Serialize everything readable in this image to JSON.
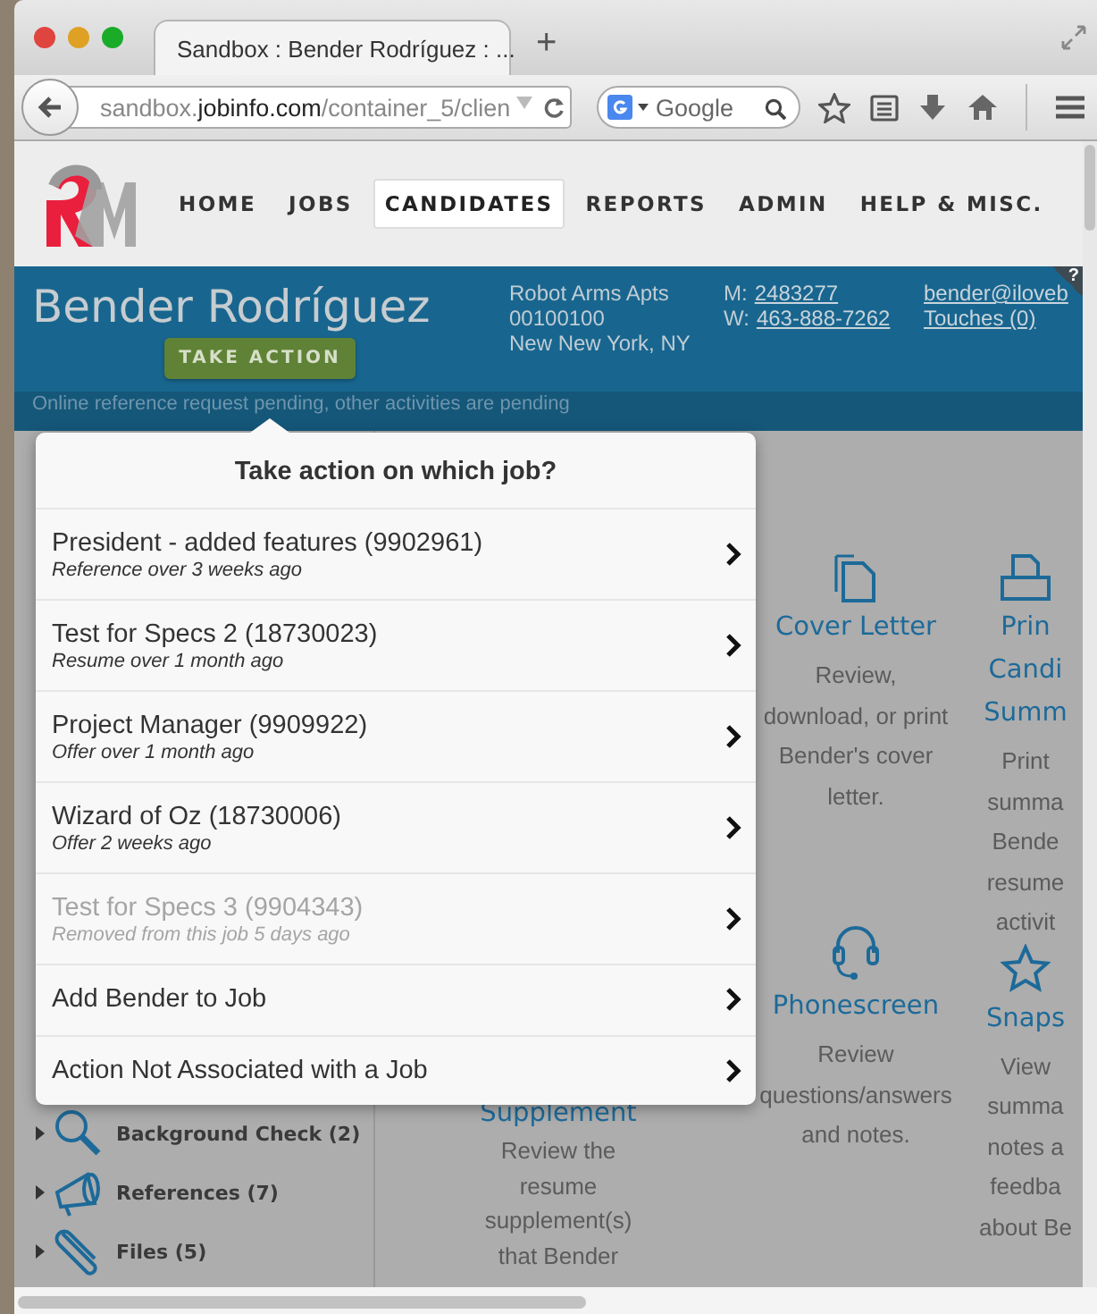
{
  "browser": {
    "tab_title": "Sandbox : Bender Rodríguez : ...",
    "new_tab": "+",
    "url": "sandbox.**jobinfo.com**/container_5/clien",
    "search": {
      "placeholder": "Google"
    }
  },
  "nav": {
    "items": [
      {
        "label": "HOME",
        "selected": false
      },
      {
        "label": "JOBS",
        "selected": false
      },
      {
        "label": "CANDIDATES",
        "selected": true
      },
      {
        "label": "REPORTS",
        "selected": false
      },
      {
        "label": "ADMIN",
        "selected": false
      },
      {
        "label": "HELP & MISC.",
        "selected": false
      }
    ]
  },
  "candidate": {
    "name": "Bender Rodríguez",
    "action_button": "TAKE ACTION",
    "address": [
      "Robot Arms Apts",
      "00100100",
      "New New York, NY"
    ],
    "phones": [
      {
        "label": "M:",
        "number": "2483277"
      },
      {
        "label": "W:",
        "number": "463-888-7262"
      }
    ],
    "links": [
      "bender@iloveb",
      "Touches (0)"
    ],
    "help": "?",
    "status": "Online reference request pending, other activities are pending"
  },
  "popup": {
    "title": "Take action on which job?",
    "items": [
      {
        "kind": "job",
        "title": "President - added features (9902961)",
        "subtitle": "Reference over 3 weeks ago",
        "disabled": false
      },
      {
        "kind": "job",
        "title": "Test for Specs 2 (18730023)",
        "subtitle": "Resume over 1 month ago",
        "disabled": false
      },
      {
        "kind": "job",
        "title": "Project Manager (9909922)",
        "subtitle": "Offer over 1 month ago",
        "disabled": false
      },
      {
        "kind": "job",
        "title": "Wizard of Oz (18730006)",
        "subtitle": "Offer 2 weeks ago",
        "disabled": false
      },
      {
        "kind": "job",
        "title": "Test for Specs 3 (9904343)",
        "subtitle": "Removed from this job 5 days ago",
        "disabled": true
      },
      {
        "kind": "action",
        "title": "Add Bender to Job",
        "disabled": false
      },
      {
        "kind": "action",
        "title": "Action Not Associated with a Job",
        "disabled": false
      }
    ]
  },
  "sidebar": {
    "items": [
      {
        "kind": "search",
        "label": "Background Check (2)"
      },
      {
        "kind": "megaphone",
        "label": "References (7)"
      },
      {
        "kind": "clip",
        "label": "Files (5)"
      }
    ]
  },
  "columns": [
    {
      "cards": [
        {
          "kind": "none",
          "title_lines": [
            "Supplement"
          ],
          "description": [
            "Review the",
            "resume",
            "supplement(s)",
            "that Bender"
          ]
        }
      ]
    },
    {
      "cards": [
        {
          "kind": "document",
          "title_lines": [
            "Cover Letter"
          ],
          "description": [
            "Review,",
            "download, or print",
            "Bender's cover",
            "letter."
          ]
        },
        {
          "kind": "headset",
          "title_lines": [
            "Phonescreen"
          ],
          "description": [
            "Review",
            "questions/answers",
            "and notes."
          ]
        }
      ]
    },
    {
      "cards": [
        {
          "kind": "print",
          "title_lines": [
            "Prin",
            "Candi",
            "Summ"
          ],
          "description": [
            "Print",
            "summa",
            "Bende",
            "resume",
            "activit"
          ]
        },
        {
          "kind": "star",
          "title_lines": [
            "Snaps"
          ],
          "description": [
            "View",
            "summa",
            "notes a",
            "feedba",
            "about Be"
          ]
        }
      ]
    }
  ]
}
